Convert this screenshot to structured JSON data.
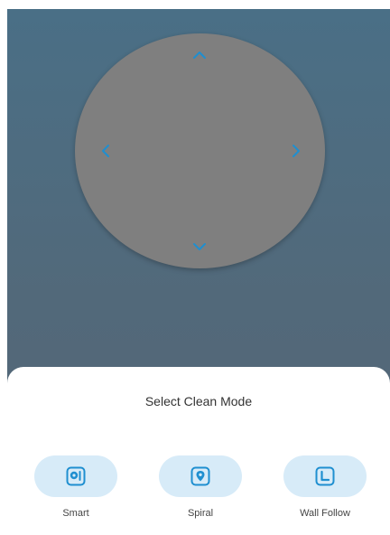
{
  "dpad": {
    "up_icon": "chevron-up-icon",
    "down_icon": "chevron-down-icon",
    "left_icon": "chevron-left-icon",
    "right_icon": "chevron-right-icon"
  },
  "clean_mode_sheet": {
    "title": "Select Clean Mode",
    "modes": [
      {
        "label": "Smart",
        "icon": "smart-mode-icon"
      },
      {
        "label": "Spiral",
        "icon": "spiral-pin-icon"
      },
      {
        "label": "Wall Follow",
        "icon": "wall-follow-icon"
      }
    ]
  },
  "colors": {
    "background_top": "#4a6f86",
    "background_bottom": "#566676",
    "dpad": "#7f7f7f",
    "accent": "#1f8fd0",
    "pill": "#d7ebf8"
  }
}
